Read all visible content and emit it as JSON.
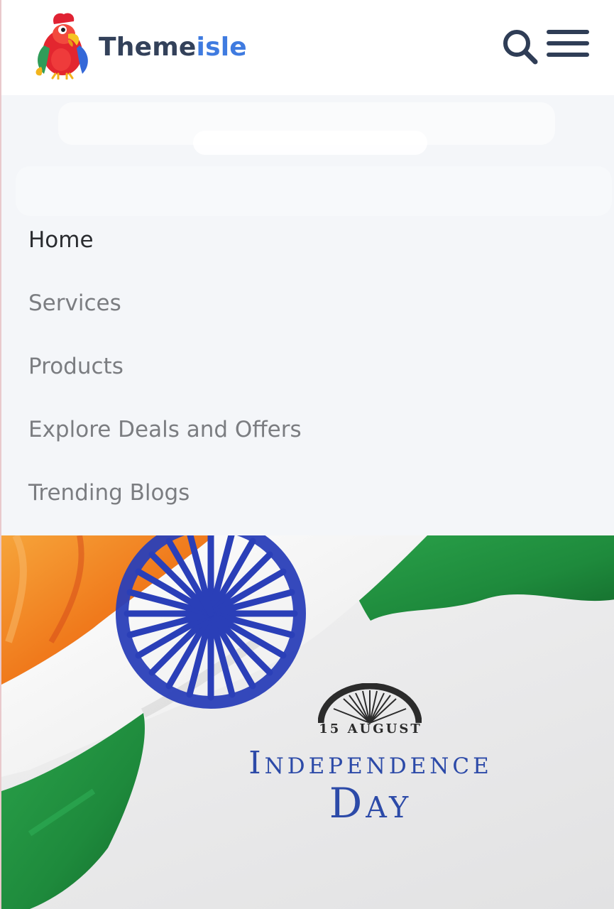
{
  "header": {
    "brand_part1": "Theme",
    "brand_part2": "isle",
    "logo_icon": "parrot-logo-icon",
    "search_icon": "search-icon",
    "menu_icon": "hamburger-menu-icon"
  },
  "nav": {
    "items": [
      {
        "label": "Home",
        "active": true
      },
      {
        "label": "Services",
        "active": false
      },
      {
        "label": "Products",
        "active": false
      },
      {
        "label": "Explore Deals and Offers",
        "active": false
      },
      {
        "label": "Trending Blogs",
        "active": false
      }
    ]
  },
  "hero": {
    "date": "15 AUGUST",
    "title_line1": "Independence",
    "title_line2": "Day",
    "image_icon": "indian-flag-image",
    "emblem_icon": "ashoka-chakra-half-icon"
  },
  "colors": {
    "brand_dark": "#33415a",
    "brand_blue": "#3f7be0",
    "nav_active": "#2a2c30",
    "nav_inactive": "#7b7d81",
    "saffron": "#f07a1c",
    "green": "#1e8a3c",
    "chakra_blue": "#2a3fb8",
    "title_blue": "#2c4aa8"
  }
}
